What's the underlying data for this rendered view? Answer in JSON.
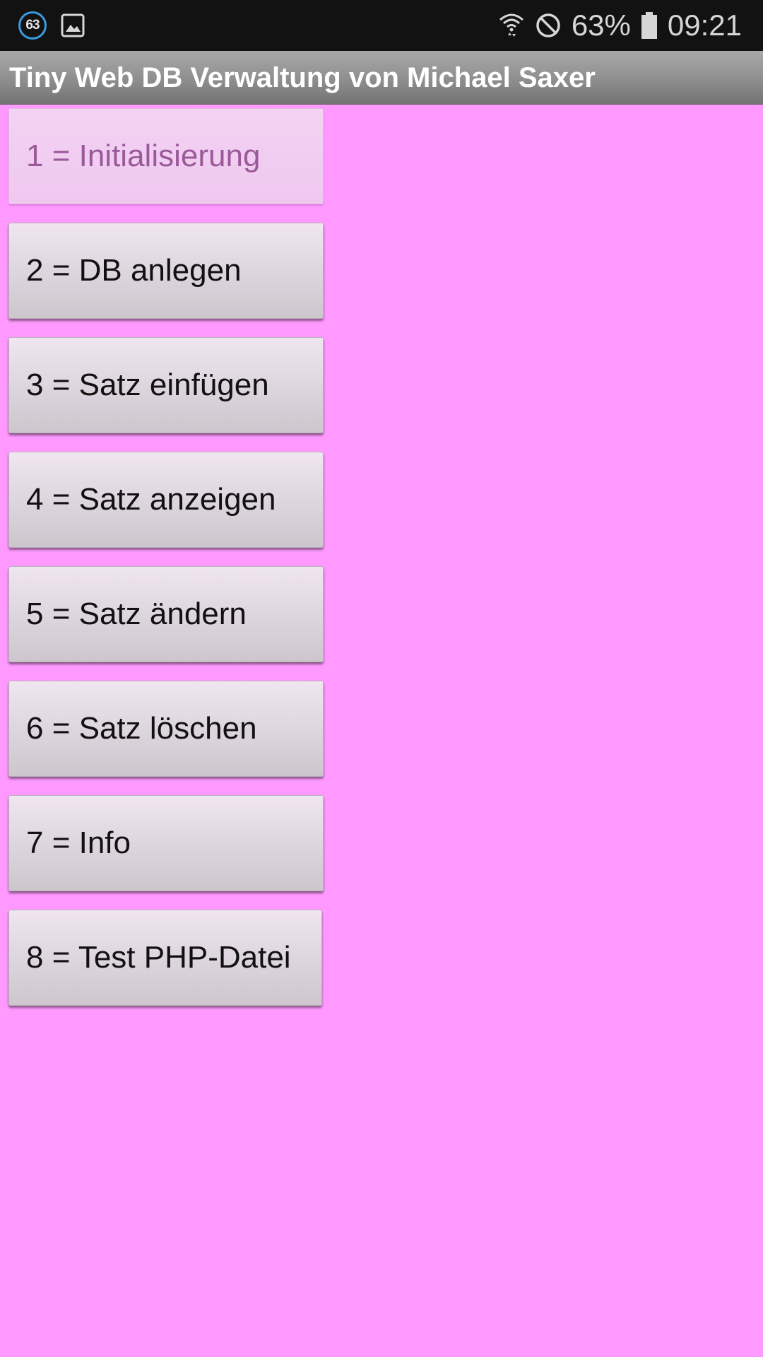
{
  "status_bar": {
    "notification_count": "63",
    "battery_percent": "63%",
    "time": "09:21",
    "icons": [
      "notification-badge-icon",
      "image-icon",
      "wifi-icon",
      "do-not-disturb-icon",
      "battery-icon"
    ]
  },
  "app": {
    "title": "Tiny Web DB Verwaltung von Michael Saxer"
  },
  "menu": {
    "buttons": [
      {
        "label": "1 = Initialisierung",
        "enabled": false
      },
      {
        "label": "2 = DB anlegen",
        "enabled": true
      },
      {
        "label": "3 = Satz einfügen",
        "enabled": true
      },
      {
        "label": "4 = Satz anzeigen",
        "enabled": true
      },
      {
        "label": "5 = Satz ändern",
        "enabled": true
      },
      {
        "label": "6 = Satz löschen",
        "enabled": true
      },
      {
        "label": "7 = Info",
        "enabled": true
      },
      {
        "label": "8 = Test PHP-Datei",
        "enabled": true
      }
    ]
  },
  "colors": {
    "background": "#ff99ff",
    "status_bar": "#121212",
    "title_bar": "#8e8e8e",
    "button": "#e0d8e0",
    "button_disabled": "#efc8ef"
  }
}
